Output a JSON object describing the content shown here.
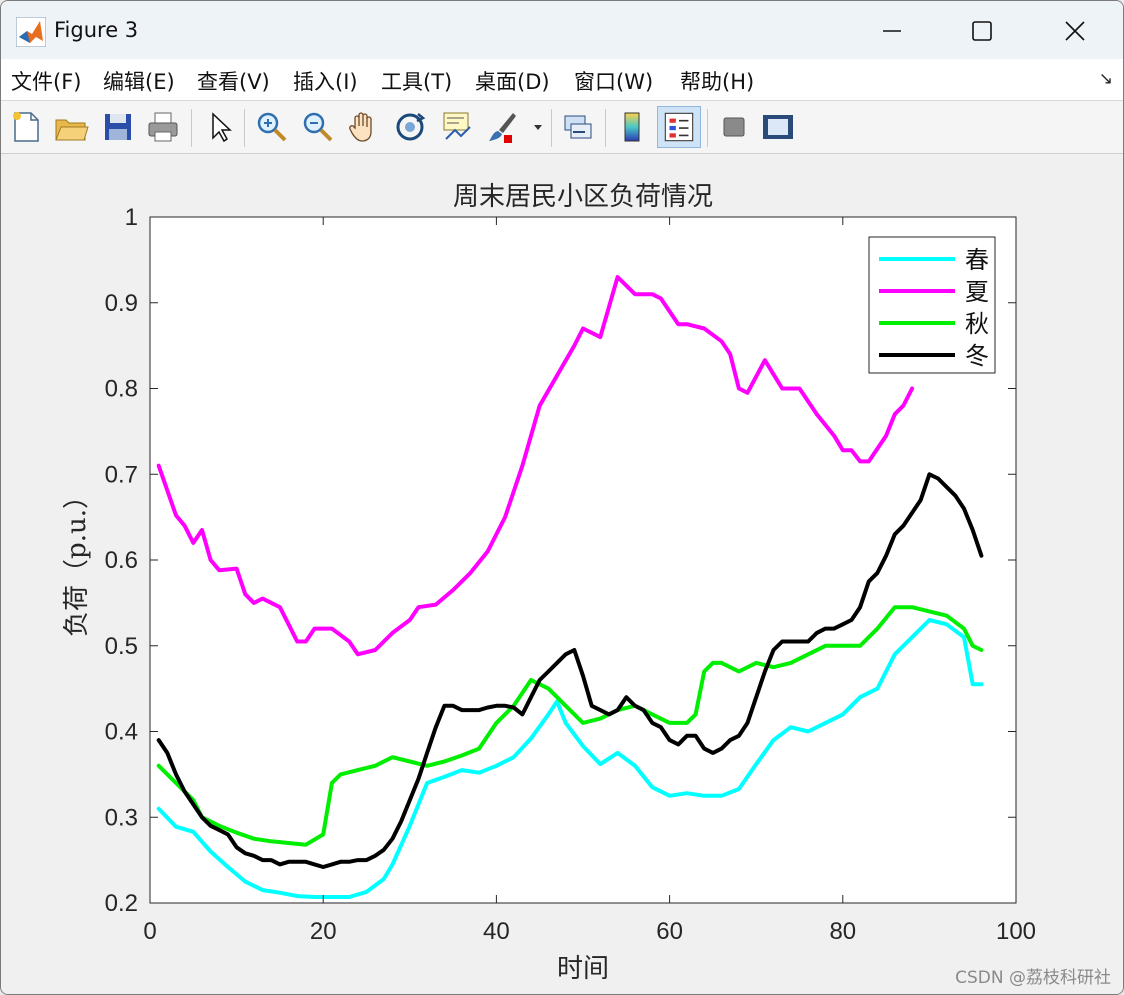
{
  "window": {
    "title": "Figure 3",
    "minimize_label": "—",
    "maximize_label": "☐",
    "close_label": "✕"
  },
  "menu": {
    "items": [
      "文件(F)",
      "编辑(E)",
      "查看(V)",
      "插入(I)",
      "工具(T)",
      "桌面(D)",
      "窗口(W)",
      "帮助(H)"
    ],
    "more_label": "↘"
  },
  "toolbar": {
    "icons": [
      "new-figure-icon",
      "open-file-icon",
      "save-icon",
      "print-icon",
      "select-arrow-icon",
      "zoom-in-icon",
      "zoom-out-icon",
      "pan-hand-icon",
      "rotate-3d-icon",
      "data-cursor-icon",
      "brush-icon",
      "link-plot-icon",
      "colorbar-icon",
      "legend-icon",
      "hide-plot-tools-icon",
      "show-plot-tools-icon"
    ]
  },
  "watermark": "CSDN @荔枝科研社",
  "colors": {
    "spring": "#00ffff",
    "summer": "#ff00ff",
    "autumn": "#00ee00",
    "winter": "#000000",
    "figure_bg": "#f0f0f0",
    "axes_bg": "#ffffff"
  },
  "chart_data": {
    "type": "line",
    "title": "周末居民小区负荷情况",
    "xlabel": "时间",
    "ylabel": "负荷（p.u.）",
    "xlim": [
      0,
      100
    ],
    "ylim": [
      0.2,
      1.0
    ],
    "xticks": [
      0,
      20,
      40,
      60,
      80,
      100
    ],
    "yticks": [
      0.2,
      0.3,
      0.4,
      0.5,
      0.6,
      0.7,
      0.8,
      0.9,
      1.0
    ],
    "ytick_labels": [
      "0.2",
      "0.3",
      "0.4",
      "0.5",
      "0.6",
      "0.7",
      "0.8",
      "0.9",
      "1"
    ],
    "grid": false,
    "legend_position": "top-right",
    "series": [
      {
        "name": "春",
        "color": "#00ffff",
        "x": [
          1,
          3,
          5,
          7,
          9,
          11,
          13,
          15,
          17,
          19,
          21,
          23,
          25,
          27,
          28,
          30,
          32,
          34,
          36,
          38,
          40,
          42,
          44,
          46,
          47,
          48,
          50,
          52,
          54,
          56,
          58,
          60,
          62,
          64,
          66,
          68,
          70,
          72,
          74,
          76,
          78,
          80,
          82,
          84,
          86,
          88,
          90,
          92,
          94,
          95,
          96
        ],
        "y": [
          0.31,
          0.289,
          0.283,
          0.26,
          0.242,
          0.225,
          0.215,
          0.212,
          0.208,
          0.207,
          0.207,
          0.207,
          0.213,
          0.228,
          0.245,
          0.29,
          0.34,
          0.347,
          0.355,
          0.352,
          0.36,
          0.37,
          0.392,
          0.42,
          0.435,
          0.41,
          0.383,
          0.362,
          0.375,
          0.36,
          0.335,
          0.325,
          0.328,
          0.325,
          0.325,
          0.333,
          0.362,
          0.39,
          0.405,
          0.4,
          0.41,
          0.42,
          0.44,
          0.45,
          0.49,
          0.51,
          0.53,
          0.525,
          0.51,
          0.455,
          0.455
        ]
      },
      {
        "name": "夏",
        "color": "#ff00ff",
        "x": [
          1,
          3,
          4,
          5,
          6,
          7,
          8,
          10,
          11,
          12,
          13,
          15,
          16,
          17,
          18,
          19,
          21,
          23,
          24,
          26,
          28,
          30,
          31,
          33,
          35,
          37,
          39,
          41,
          43,
          45,
          47,
          49,
          50,
          52,
          54,
          56,
          58,
          59,
          61,
          62,
          64,
          66,
          67,
          68,
          69,
          71,
          73,
          75,
          77,
          79,
          80,
          81,
          82,
          83,
          85,
          86,
          87,
          88
        ],
        "y": [
          0.71,
          0.652,
          0.64,
          0.62,
          0.635,
          0.6,
          0.588,
          0.59,
          0.56,
          0.55,
          0.555,
          0.545,
          0.525,
          0.505,
          0.505,
          0.52,
          0.52,
          0.505,
          0.49,
          0.495,
          0.515,
          0.53,
          0.545,
          0.548,
          0.565,
          0.585,
          0.61,
          0.65,
          0.71,
          0.78,
          0.815,
          0.85,
          0.87,
          0.86,
          0.93,
          0.91,
          0.91,
          0.905,
          0.875,
          0.875,
          0.87,
          0.855,
          0.84,
          0.8,
          0.795,
          0.833,
          0.8,
          0.8,
          0.77,
          0.745,
          0.728,
          0.728,
          0.715,
          0.715,
          0.745,
          0.77,
          0.78,
          0.8
        ]
      },
      {
        "name": "秋",
        "color": "#00ee00",
        "x": [
          1,
          3,
          5,
          6,
          8,
          10,
          12,
          14,
          16,
          18,
          20,
          21,
          22,
          24,
          26,
          28,
          30,
          32,
          34,
          36,
          38,
          40,
          42,
          44,
          46,
          48,
          50,
          52,
          54,
          56,
          58,
          60,
          62,
          63,
          64,
          65,
          66,
          68,
          70,
          72,
          74,
          76,
          78,
          80,
          82,
          84,
          86,
          88,
          90,
          92,
          94,
          95,
          96
        ],
        "y": [
          0.36,
          0.34,
          0.32,
          0.3,
          0.29,
          0.282,
          0.275,
          0.272,
          0.27,
          0.268,
          0.28,
          0.34,
          0.35,
          0.355,
          0.36,
          0.37,
          0.365,
          0.36,
          0.365,
          0.372,
          0.38,
          0.41,
          0.43,
          0.46,
          0.45,
          0.43,
          0.41,
          0.415,
          0.425,
          0.43,
          0.42,
          0.41,
          0.41,
          0.42,
          0.47,
          0.48,
          0.48,
          0.47,
          0.48,
          0.475,
          0.48,
          0.49,
          0.5,
          0.5,
          0.5,
          0.52,
          0.545,
          0.545,
          0.54,
          0.535,
          0.52,
          0.5,
          0.495
        ]
      },
      {
        "name": "冬",
        "color": "#000000",
        "x": [
          1,
          2,
          3,
          4,
          5,
          6,
          7,
          8,
          9,
          10,
          11,
          12,
          13,
          14,
          15,
          16,
          17,
          18,
          19,
          20,
          21,
          22,
          23,
          24,
          25,
          26,
          27,
          28,
          29,
          30,
          31,
          32,
          33,
          34,
          35,
          36,
          37,
          38,
          39,
          40,
          41,
          42,
          43,
          44,
          45,
          46,
          47,
          48,
          49,
          50,
          51,
          52,
          53,
          54,
          55,
          56,
          57,
          58,
          59,
          60,
          61,
          62,
          63,
          64,
          65,
          66,
          67,
          68,
          69,
          70,
          71,
          72,
          73,
          74,
          75,
          76,
          77,
          78,
          79,
          80,
          81,
          82,
          83,
          84,
          85,
          86,
          87,
          88,
          89,
          90,
          91,
          92,
          93,
          94,
          95,
          96
        ],
        "y": [
          0.39,
          0.375,
          0.35,
          0.33,
          0.315,
          0.3,
          0.29,
          0.285,
          0.28,
          0.265,
          0.258,
          0.255,
          0.25,
          0.25,
          0.245,
          0.248,
          0.248,
          0.248,
          0.245,
          0.242,
          0.245,
          0.248,
          0.248,
          0.25,
          0.25,
          0.255,
          0.262,
          0.275,
          0.295,
          0.32,
          0.345,
          0.375,
          0.405,
          0.43,
          0.43,
          0.425,
          0.425,
          0.425,
          0.428,
          0.43,
          0.43,
          0.428,
          0.42,
          0.44,
          0.46,
          0.47,
          0.48,
          0.49,
          0.495,
          0.465,
          0.43,
          0.425,
          0.42,
          0.425,
          0.44,
          0.43,
          0.425,
          0.41,
          0.405,
          0.39,
          0.385,
          0.395,
          0.395,
          0.38,
          0.375,
          0.38,
          0.39,
          0.395,
          0.41,
          0.44,
          0.47,
          0.495,
          0.505,
          0.505,
          0.505,
          0.505,
          0.515,
          0.52,
          0.52,
          0.525,
          0.53,
          0.545,
          0.575,
          0.585,
          0.605,
          0.63,
          0.64,
          0.655,
          0.67,
          0.7,
          0.695,
          0.685,
          0.675,
          0.66,
          0.635,
          0.605
        ]
      }
    ]
  }
}
